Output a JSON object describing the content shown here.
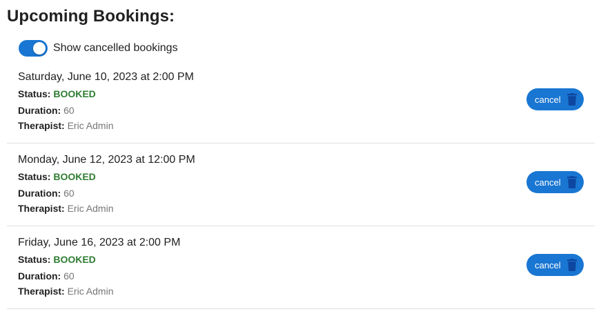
{
  "page": {
    "title": "Upcoming Bookings:"
  },
  "toggle": {
    "label": "Show cancelled bookings",
    "checked": true
  },
  "labels": {
    "status": "Status:",
    "duration": "Duration:",
    "therapist": "Therapist:",
    "cancel": "cancel"
  },
  "colors": {
    "accent": "#1976d2",
    "status_booked": "#2e7d32",
    "trash_icon": "#0d47a1"
  },
  "bookings": [
    {
      "date": "Saturday, June 10, 2023 at 2:00 PM",
      "status": "BOOKED",
      "duration": "60",
      "therapist": "Eric Admin"
    },
    {
      "date": "Monday, June 12, 2023 at 12:00 PM",
      "status": "BOOKED",
      "duration": "60",
      "therapist": "Eric Admin"
    },
    {
      "date": "Friday, June 16, 2023 at 2:00 PM",
      "status": "BOOKED",
      "duration": "60",
      "therapist": "Eric Admin"
    }
  ]
}
